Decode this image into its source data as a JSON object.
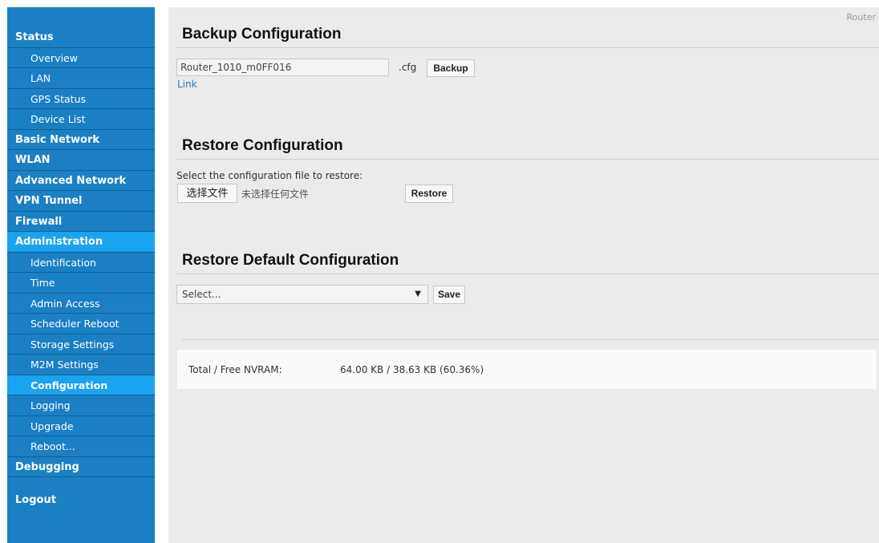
{
  "sidebar": {
    "items": [
      {
        "label": "Status",
        "level": "top"
      },
      {
        "label": "Overview",
        "level": "sub"
      },
      {
        "label": "LAN",
        "level": "sub"
      },
      {
        "label": "GPS Status",
        "level": "sub"
      },
      {
        "label": "Device List",
        "level": "sub"
      },
      {
        "label": "Basic Network",
        "level": "top"
      },
      {
        "label": "WLAN",
        "level": "top"
      },
      {
        "label": "Advanced Network",
        "level": "top"
      },
      {
        "label": "VPN Tunnel",
        "level": "top"
      },
      {
        "label": "Firewall",
        "level": "top"
      },
      {
        "label": "Administration",
        "level": "top"
      },
      {
        "label": "Identification",
        "level": "sub"
      },
      {
        "label": "Time",
        "level": "sub"
      },
      {
        "label": "Admin Access",
        "level": "sub"
      },
      {
        "label": "Scheduler Reboot",
        "level": "sub"
      },
      {
        "label": "Storage Settings",
        "level": "sub"
      },
      {
        "label": "M2M Settings",
        "level": "sub"
      },
      {
        "label": "Configuration",
        "level": "sub"
      },
      {
        "label": "Logging",
        "level": "sub"
      },
      {
        "label": "Upgrade",
        "level": "sub"
      },
      {
        "label": "Reboot...",
        "level": "sub"
      },
      {
        "label": "Debugging",
        "level": "top"
      }
    ],
    "logout": "Logout"
  },
  "header": {
    "router_label": "Router"
  },
  "backup": {
    "title": "Backup Configuration",
    "filename_value": "Router_1010_m0FF016",
    "extension": ".cfg",
    "backup_button": "Backup",
    "link": "Link"
  },
  "restore": {
    "title": "Restore Configuration",
    "prompt": "Select the configuration file to restore:",
    "choose_file_button": "选择文件",
    "no_file_text": "未选择任何文件",
    "restore_button": "Restore"
  },
  "restore_default": {
    "title": "Restore Default Configuration",
    "select_value": "Select...",
    "save_button": "Save"
  },
  "nvram": {
    "label": "Total / Free NVRAM:",
    "value": "64.00 KB / 38.63 KB (60.36%)"
  }
}
